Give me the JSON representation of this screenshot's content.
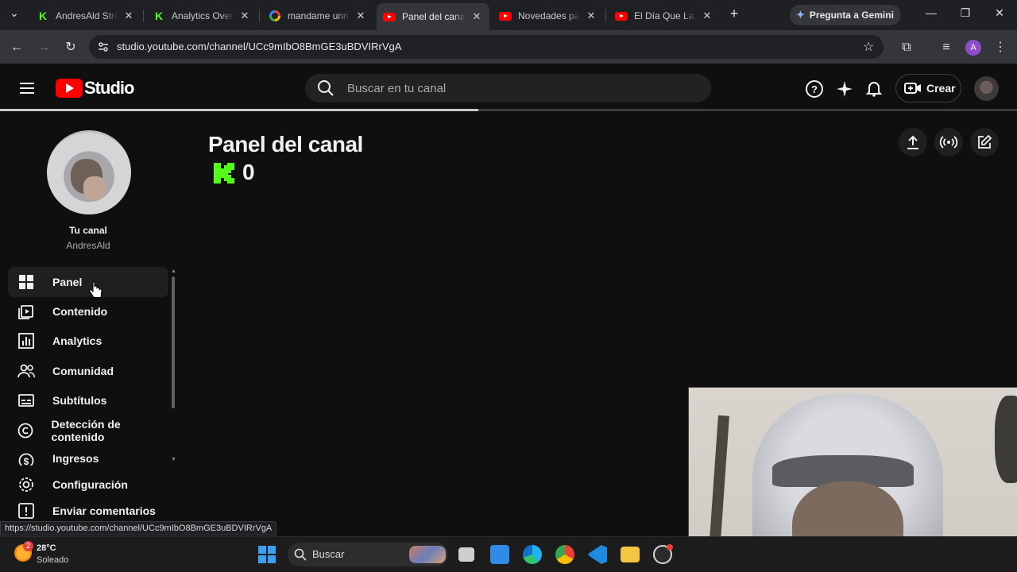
{
  "browser": {
    "tabs": [
      {
        "title": "AndresAld Stream",
        "icon": "kick-icon",
        "active": false
      },
      {
        "title": "Analytics Overview",
        "icon": "kick-icon",
        "active": false
      },
      {
        "title": "mandame unmensaje",
        "icon": "google-icon",
        "active": false
      },
      {
        "title": "Panel del canal",
        "icon": "youtube-icon",
        "active": true
      },
      {
        "title": "Novedades para",
        "icon": "youtube-icon",
        "active": false
      },
      {
        "title": "El Día Que La Él",
        "icon": "youtube-icon",
        "active": false
      }
    ],
    "gemini_label": "Pregunta a Gemini",
    "url": "studio.youtube.com/channel/UCc9mIbO8BmGE3uBDVIRrVgA",
    "profile_initial": "A",
    "status_url": "https://studio.youtube.com/channel/UCc9mIbO8BmGE3uBDVIRrVgA"
  },
  "header": {
    "logo_text": "Studio",
    "search_placeholder": "Buscar en tu canal",
    "create_label": "Crear",
    "load_progress": 0.47
  },
  "sidebar": {
    "channel_label": "Tu canal",
    "channel_name": "AndresAld",
    "items": [
      {
        "label": "Panel",
        "icon": "dashboard-icon",
        "active": true
      },
      {
        "label": "Contenido",
        "icon": "content-icon",
        "active": false
      },
      {
        "label": "Analytics",
        "icon": "analytics-icon",
        "active": false
      },
      {
        "label": "Comunidad",
        "icon": "community-icon",
        "active": false
      },
      {
        "label": "Subtítulos",
        "icon": "subtitles-icon",
        "active": false
      },
      {
        "label": "Detección de contenido",
        "icon": "copyright-icon",
        "active": false
      },
      {
        "label": "Ingresos",
        "icon": "earn-icon",
        "active": false
      }
    ],
    "footer_items": [
      {
        "label": "Configuración",
        "icon": "settings-icon"
      },
      {
        "label": "Enviar comentarios",
        "icon": "feedback-icon"
      }
    ]
  },
  "main": {
    "title": "Panel del canal",
    "kick_count": "0"
  },
  "taskbar": {
    "weather_temp": "28°C",
    "weather_desc": "Soleado",
    "weather_badge": "2",
    "search_label": "Buscar"
  },
  "colors": {
    "yt_red": "#ff0000",
    "kick_green": "#53fc18",
    "background": "#0f0f0f"
  }
}
